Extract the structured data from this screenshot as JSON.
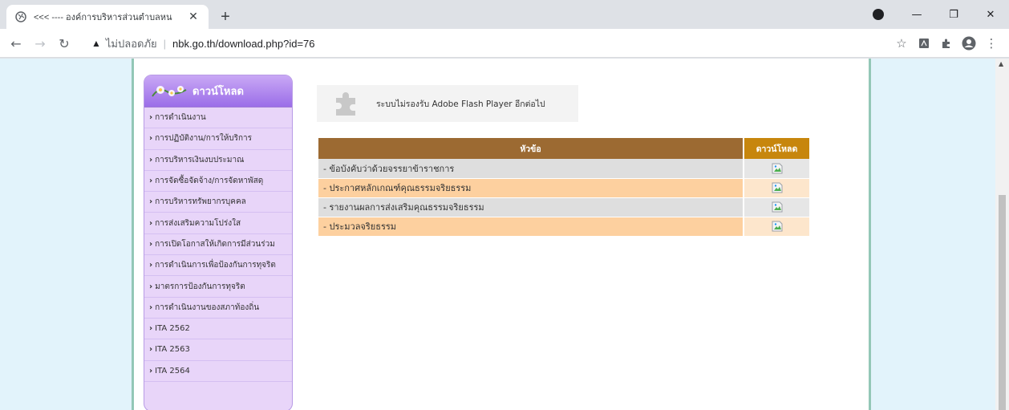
{
  "browser": {
    "tab_title": "<<< ---- องค์การบริหารส่วนตำบลหน",
    "new_tab_symbol": "+",
    "security_label": "ไม่ปลอดภัย",
    "url": "nbk.go.th/download.php?id=76"
  },
  "sidebar": {
    "title": "ดาวน์โหลด",
    "items": [
      {
        "label": "การดำเนินงาน"
      },
      {
        "label": "การปฏิบัติงาน/การให้บริการ"
      },
      {
        "label": "การบริหารเงินงบประมาณ"
      },
      {
        "label": "การจัดซื้อจัดจ้าง/การจัดหาพัสดุ"
      },
      {
        "label": "การบริหารทรัพยากรบุคคล"
      },
      {
        "label": "การส่งเสริมความโปร่งใส"
      },
      {
        "label": "การเปิดโอกาสให้เกิดการมีส่วนร่วม"
      },
      {
        "label": "การดำเนินการเพื่อป้องกันการทุจริต"
      },
      {
        "label": "มาตรการป้องกันการทุจริต"
      },
      {
        "label": "การดำเนินงานของสภาท้องถิ่น"
      },
      {
        "label": "ITA 2562"
      },
      {
        "label": "ITA 2563"
      },
      {
        "label": "ITA 2564"
      }
    ]
  },
  "flash_notice": "ระบบไม่รองรับ Adobe Flash Player อีกต่อไป",
  "table": {
    "headers": [
      "หัวข้อ",
      "ดาวน์โหลด"
    ],
    "rows": [
      {
        "topic": "- ข้อบังคับว่าด้วยจรรยาข้าราชการ"
      },
      {
        "topic": "- ประกาศหลักเกณฑ์คุณธรรมจริยธรรม"
      },
      {
        "topic": "- รายงานผลการส่งเสริมคุณธรรมจริยธรรม"
      },
      {
        "topic": "- ประมวลจริยธรรม"
      }
    ]
  },
  "colors": {
    "page_background": "#e2f3fb",
    "sidebar_bg": "#e8d5f9",
    "sidebar_header": "#9b6ee8",
    "table_header": "#9c6a32",
    "table_header_dl": "#c7860d",
    "row_orange": "#fdd09f",
    "row_grey": "#dedede"
  }
}
